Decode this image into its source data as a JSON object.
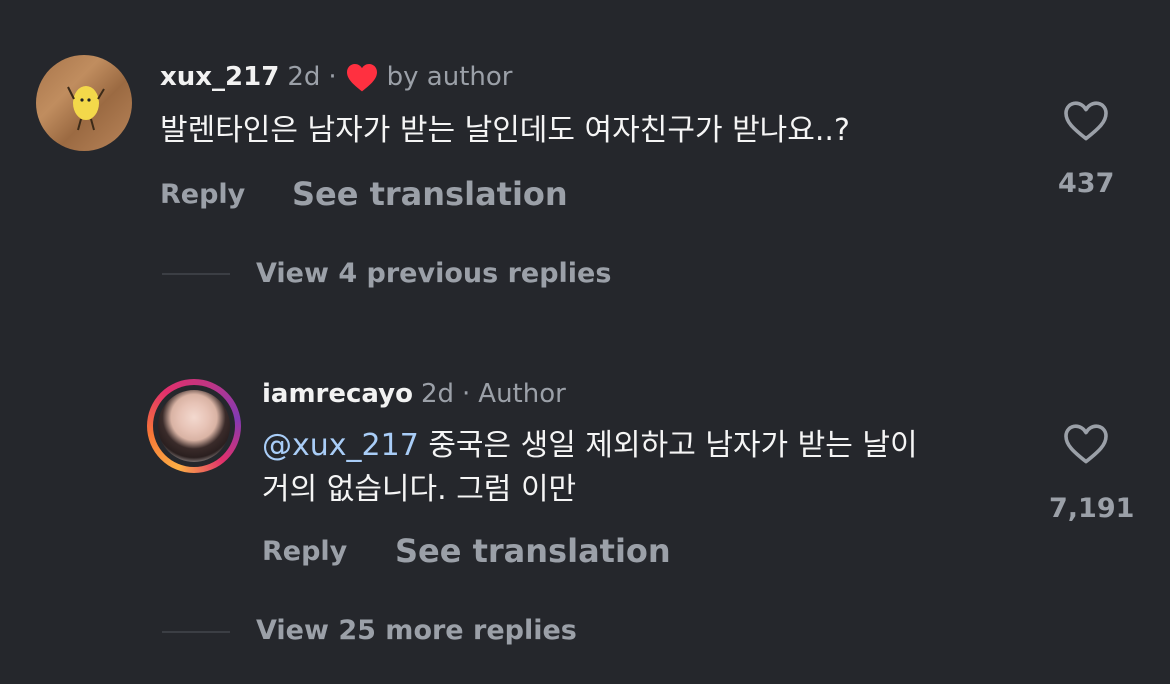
{
  "comment": {
    "username": "xux_217",
    "time": "2d",
    "dot": "·",
    "liked_by": "by author",
    "text": "발렌타인은 남자가 받는 날인데도 여자친구가 받나요..?",
    "reply_label": "Reply",
    "translate_label": "See translation",
    "like_count": "437",
    "view_replies": "View 4 previous replies"
  },
  "reply": {
    "username": "iamrecayo",
    "time": "2d",
    "dot": "·",
    "role": "Author",
    "mention": "@xux_217",
    "text_line1": " 중국은 생일 제외하고 남자가 받는 날이",
    "text_line2": "거의 없습니다. 그럼 이만",
    "reply_label": "Reply",
    "translate_label": "See translation",
    "like_count": "7,191",
    "view_more": "View 25 more replies"
  },
  "colors": {
    "background": "#25272c",
    "secondary_text": "#9ba0a8",
    "mention": "#a9cdf7",
    "heart": "#ff3040"
  },
  "icons": [
    "red-heart-icon",
    "heart-outline-icon"
  ]
}
